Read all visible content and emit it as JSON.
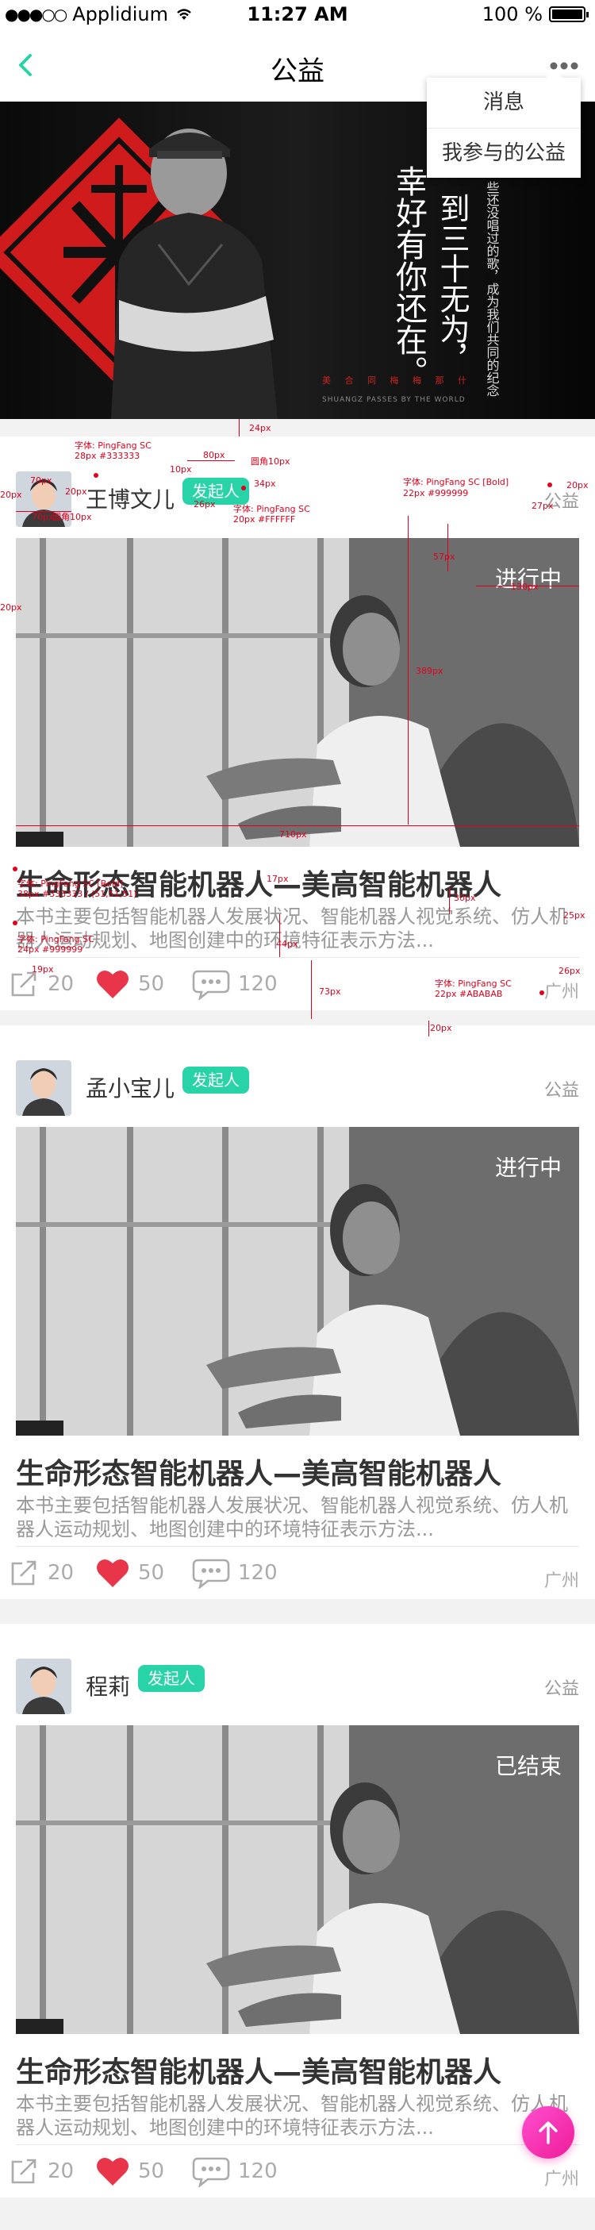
{
  "status_bar": {
    "carrier": "Applidium",
    "time": "11:27 AM",
    "battery": "100 %"
  },
  "nav": {
    "title": "公益"
  },
  "menu": {
    "items": [
      "消息",
      "我参与的公益"
    ]
  },
  "banner": {
    "big_text": "幸好有你还在。",
    "text_col2": "到三十无为，",
    "text_col3": "些还没唱过的歌，成为我们共同的纪念",
    "tagline": "美 合 同 梅 梅 那 什",
    "tagline_en": "SHUANGZ PASSES BY THE WORLD",
    "slide_count": 3,
    "active_slide": 0
  },
  "cards": [
    {
      "user": "王博文儿",
      "badge": "发起人",
      "category": "公益",
      "status": "进行中",
      "title": "生命形态智能机器人—美高智能机器人",
      "desc": "本书主要包括智能机器人发展状况、智能机器人视觉系统、仿人机器人运动规划、地图创建中的环境特征表示方法...",
      "shares": "20",
      "likes": "50",
      "comments": "120",
      "location": "广州"
    },
    {
      "user": "孟小宝儿",
      "badge": "发起人",
      "category": "公益",
      "status": "进行中",
      "title": "生命形态智能机器人—美高智能机器人",
      "desc": "本书主要包括智能机器人发展状况、智能机器人视觉系统、仿人机器人运动规划、地图创建中的环境特征表示方法...",
      "shares": "20",
      "likes": "50",
      "comments": "120",
      "location": "广州"
    },
    {
      "user": "程莉",
      "badge": "发起人",
      "category": "公益",
      "status": "已结束",
      "title": "生命形态智能机器人—美高智能机器人",
      "desc": "本书主要包括智能机器人发展状况、智能机器人视觉系统、仿人机器人运动规划、地图创建中的环境特征表示方法...",
      "shares": "20",
      "likes": "50",
      "comments": "120",
      "location": "广州"
    }
  ],
  "annotations": {
    "a1": "24px",
    "a2": "字体: PingFang SC",
    "a3": "28px #333333",
    "a4": "80px",
    "a5": "10px",
    "a6": "圆角10px",
    "a7": "70px",
    "a8": "20px",
    "a9": "20px",
    "a10": "70px",
    "a11": "圆角10px",
    "a12": "26px",
    "a13": "34px",
    "a14": "字体: PingFang SC",
    "a15": "20px #FFFFFF",
    "a16": "字体: PingFang SC [Bold]",
    "a17": "22px #999999",
    "a18": "20px",
    "a19": "27px",
    "a20": "20px",
    "a21": "57px",
    "a22": "130px",
    "a23": "389px",
    "a24": "710px",
    "a25": "字体: PingFang SC [Bold]",
    "a26": "38px #333333 / (51,51,51)",
    "a27": "17px",
    "a28": "30px",
    "a29": "25px",
    "a30": "字体: PingFang SC",
    "a31": "24px #999999",
    "a32": "44px",
    "a33": "19px",
    "a34": "73px",
    "a35": "字体: PingFang SC",
    "a36": "22px #ABABAB",
    "a37": "26px",
    "a38": "20px"
  },
  "colors": {
    "accent": "#29d3a8",
    "like": "#e8354a",
    "fab": "#ee1c98",
    "annotation": "#e1001c"
  }
}
